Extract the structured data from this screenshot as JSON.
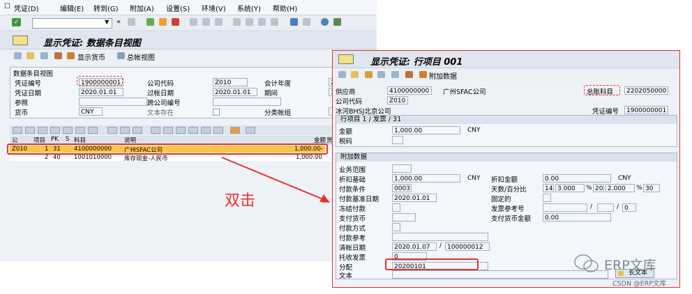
{
  "menu": {
    "items": [
      "凭证(D)",
      "编辑(E)",
      "转到(G)",
      "附加(A)",
      "设置(S)",
      "环境(V)",
      "系统(Y)",
      "帮助(H)"
    ]
  },
  "toolbar": {
    "command_value": ""
  },
  "screen1": {
    "title": "显示凭证: 数据条目视图",
    "app_buttons": {
      "display_currency": "显示货币",
      "general_ledger_view": "总帐视图"
    },
    "section_title": "数据条目视图",
    "fields": {
      "doc_number_label": "凭证编号",
      "doc_number": "1900000001",
      "company_code_label": "公司代码",
      "company_code": "Z010",
      "fiscal_year_label": "会计年度",
      "fiscal_year": "2",
      "doc_date_label": "凭证日期",
      "doc_date": "2020.01.01",
      "posting_date_label": "过帐日期",
      "posting_date": "2020.01.01",
      "period_label": "期间",
      "period": "1",
      "reference_label": "参照",
      "reference": "",
      "cross_cc_label": "跨公司编号",
      "cross_cc": "",
      "currency_label": "货币",
      "currency": "CNY",
      "text_exists_label": "文本存在",
      "ledger_group_label": "分类帐组"
    },
    "grid": {
      "headers": [
        "公",
        "项目",
        "PK",
        "S",
        "科目",
        "说明",
        "金额",
        "货"
      ],
      "rows": [
        {
          "cc": "Z010",
          "item": "1",
          "pk": "31",
          "s": "",
          "account": "4100000000",
          "desc": "广州SFAC公司",
          "amount": "1,000.00-"
        },
        {
          "cc": "",
          "item": "2",
          "pk": "40",
          "s": "",
          "account": "1001010000",
          "desc": "库存现金-人民币",
          "amount": "1,000.00"
        }
      ]
    }
  },
  "annotation": {
    "double_click": "双击"
  },
  "screen2": {
    "title": "显示凭证: 行项目 001",
    "app_buttons": {
      "additional_data": "附加数据"
    },
    "header": {
      "vendor_label": "供应商",
      "vendor": "4100000000",
      "vendor_name": "广州SFAC公司",
      "gl_label": "总账科目",
      "gl": "2202050000",
      "company_code_label": "公司代码",
      "company_code": "Z010",
      "address": "冰河BHSJ北京公司",
      "doc_number_label": "凭证编号",
      "doc_number": "1900000001"
    },
    "line_section": {
      "title": "行项目 1 / 发票 / 31",
      "amount_label": "金额",
      "amount": "1,000.00",
      "currency": "CNY",
      "tax_code_label": "税码",
      "tax_code": ""
    },
    "additional": {
      "title": "附加数据",
      "business_area_label": "业务范围",
      "business_area": "",
      "discount_base_label": "折扣基础",
      "discount_base": "1,000.00",
      "discount_base_cur": "CNY",
      "discount_amount_label": "折扣金额",
      "discount_amount": "0.00",
      "discount_amount_cur": "CNY",
      "payment_terms_label": "付款条件",
      "payment_terms": "0003",
      "days_pct_label": "天数/百分比",
      "days1": "14",
      "pct1": "3.000",
      "days2": "20",
      "pct2": "2.000",
      "days3": "30",
      "pct_sign": "%",
      "baseline_date_label": "付款基准日期",
      "baseline_date": "2020.01.01",
      "fixed_label": "固定的",
      "frozen_label": "冻结付款",
      "invoice_ref_label": "发票参考号",
      "invoice_ref_1": "",
      "invoice_ref_2": "",
      "invoice_ref_3": "0",
      "pay_currency_label": "支付货币",
      "pay_currency": "",
      "pay_currency_amt_label": "支付货币金额",
      "pay_currency_amt": "0.00",
      "pay_method_label": "付款方式",
      "pay_method": "",
      "pay_ref_label": "付款参考",
      "pay_ref": "",
      "clearing_label": "清帐日期",
      "clearing_date": "2020.01.07",
      "clearing_doc": "100000012",
      "dunning_label": "托收发票",
      "dunning": "0",
      "assignment_label": "分配",
      "assignment": "20200101",
      "text_label": "文本",
      "text": "",
      "long_text_btn": "长文本"
    }
  },
  "watermark": {
    "brand": "ERP文库",
    "source": "CSDN @ERP文库"
  },
  "colors": {
    "highlight": "#f5c84a",
    "accent_red": "#e8302a"
  }
}
